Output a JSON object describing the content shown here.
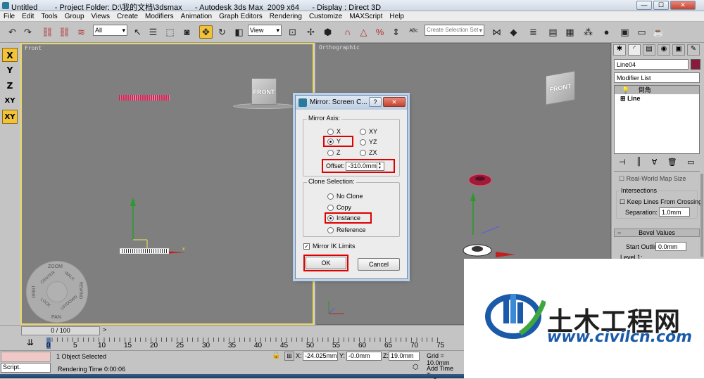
{
  "window": {
    "title": "Untitled        - Project Folder: D:\\我的文档\\3dsmax      - Autodesk 3ds Max  2009 x64      - Display : Direct 3D",
    "min": "—",
    "max": "☐",
    "close": "✕"
  },
  "menu": [
    "File",
    "Edit",
    "Tools",
    "Group",
    "Views",
    "Create",
    "Modifiers",
    "Animation",
    "Graph Editors",
    "Rendering",
    "Customize",
    "MAXScript",
    "Help"
  ],
  "toolbar": {
    "selection_filter": "All",
    "ref_coord": "View",
    "named_selection_placeholder": "Create Selection Set"
  },
  "axis_constraints": [
    "X",
    "Y",
    "Z",
    "XY",
    "XY"
  ],
  "viewports": {
    "front_label": "Front",
    "ortho_label": "Orthographic",
    "viewcube_label": "FRONT",
    "viewcube_ortho_label": "FRONT",
    "steering_wheel": [
      "ZOOM",
      "ORBIT",
      "CENTER",
      "WALK",
      "REWIND",
      "LOOK",
      "UP/DOWN",
      "PAN"
    ]
  },
  "command_panel": {
    "object_name": "Line04",
    "modifier_list": "Modifier List",
    "stack": [
      "倒角",
      "Line"
    ],
    "real_world": "Real-World Map Size",
    "intersections_group": "Intersections",
    "keep_lines": "Keep Lines From Crossing",
    "separation_label": "Separation:",
    "separation_value": "1.0mm",
    "bevel_values_rollout": "Bevel Values",
    "start_outline_label": "Start Outline:",
    "start_outline_value": "0.0mm",
    "level1_label": "Level 1:"
  },
  "dialog": {
    "title": "Mirror: Screen C...",
    "help": "?",
    "close": "✕",
    "mirror_axis_group": "Mirror Axis:",
    "axes": [
      {
        "label": "X",
        "selected": false
      },
      {
        "label": "XY",
        "selected": false
      },
      {
        "label": "Y",
        "selected": true
      },
      {
        "label": "YZ",
        "selected": false
      },
      {
        "label": "Z",
        "selected": false
      },
      {
        "label": "ZX",
        "selected": false
      }
    ],
    "offset_label": "Offset:",
    "offset_value": "-310.0mm",
    "clone_group": "Clone Selection:",
    "clone_options": [
      {
        "label": "No Clone",
        "selected": false
      },
      {
        "label": "Copy",
        "selected": false
      },
      {
        "label": "Instance",
        "selected": true
      },
      {
        "label": "Reference",
        "selected": false
      }
    ],
    "mirror_ik": "Mirror IK Limits",
    "mirror_ik_checked": true,
    "ok": "OK",
    "cancel": "Cancel"
  },
  "timeline": {
    "frame_label": "0 / 100",
    "ruler_numbers": [
      "0",
      "5",
      "10",
      "15",
      "20",
      "25",
      "30",
      "35",
      "40",
      "45",
      "50",
      "55",
      "60",
      "65",
      "70",
      "75"
    ]
  },
  "status": {
    "maxscript": "Script.",
    "selected": "1 Object Selected",
    "render_time": "Rendering Time  0:00:06",
    "x_label": "X:",
    "x_value": "-24.025mm",
    "y_label": "Y:",
    "y_value": "-0.0mm",
    "z_label": "Z:",
    "z_value": "19.0mm",
    "grid": "Grid = 10.0mm",
    "add_time_tag": "Add Time Tag"
  },
  "watermark": {
    "title": "土木工程网",
    "url": "www.civilcn.com",
    "brand_blue": "#1a5aa8",
    "brand_green": "#3fa53f"
  },
  "colors": {
    "viewport_bg": "#7f7f7f",
    "active_viewport_border": "#e8d86a",
    "highlight_red": "#e00000",
    "shape_pink": "#c0305a",
    "object_swatch": "#8a1a3a"
  }
}
